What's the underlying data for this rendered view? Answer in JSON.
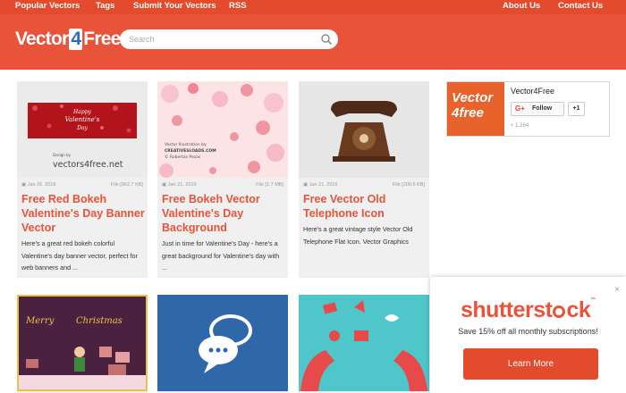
{
  "nav": {
    "left": [
      "Popular Vectors",
      "Tags",
      "Submit Your Vectors",
      "RSS"
    ],
    "right": [
      "About Us",
      "Contact Us"
    ]
  },
  "header": {
    "logo_prefix": "Vector",
    "logo_num": "4",
    "logo_suffix": "Free",
    "search_placeholder": "Search"
  },
  "cards": [
    {
      "date": "Jan 26, 2016",
      "size": "File [962.7 KB]",
      "title": "Free Red Bokeh Valentine's Day Banner Vector",
      "desc": "Here's a great red bokeh colorful Valentine's day banner vector, perfect for web banners and ...",
      "thumb_text": [
        "Happy",
        "Valentine's",
        "Day",
        "Design by",
        "vectors4free.net"
      ]
    },
    {
      "date": "Jan 21, 2016",
      "size": "File [1.7 MB]",
      "title": "Free Bokeh Vector Valentine's Day Background",
      "desc": "Just in time for Valentine's Day - here's a great background for Valentine's day with ...",
      "thumb_text": [
        "Vector Illustration by",
        "CREATIVESLOADS.COM",
        "© Robertas Pezas"
      ]
    },
    {
      "date": "Jan 21, 2016",
      "size": "File [200.6 KB]",
      "title": "Free Vector Old Telephone Icon",
      "desc": "Here's a great vintage style Vector Old Telephone Flat Icon. Vector Graphics"
    }
  ],
  "row2": {
    "christmas_text": [
      "Merry",
      "Christmas"
    ]
  },
  "widget": {
    "logo_line1": "Vector",
    "logo_line2": "4free",
    "name": "Vector4Free",
    "follow_icon": "G+",
    "follow_label": "Follow",
    "plus_one": "+1",
    "count": "+ 1,264"
  },
  "ad": {
    "close": "×",
    "brand_a": "shutterst",
    "brand_b": "ck",
    "tm": "™",
    "text": "Save 15% off all monthly subscriptions!",
    "button": "Learn More"
  },
  "colors": {
    "brand_orange": "#e8533a",
    "nav_red": "#e34b2c",
    "card_bg": "#f0f0f0"
  },
  "icons": [
    "search-icon",
    "calendar-icon",
    "file-icon",
    "close-icon"
  ]
}
